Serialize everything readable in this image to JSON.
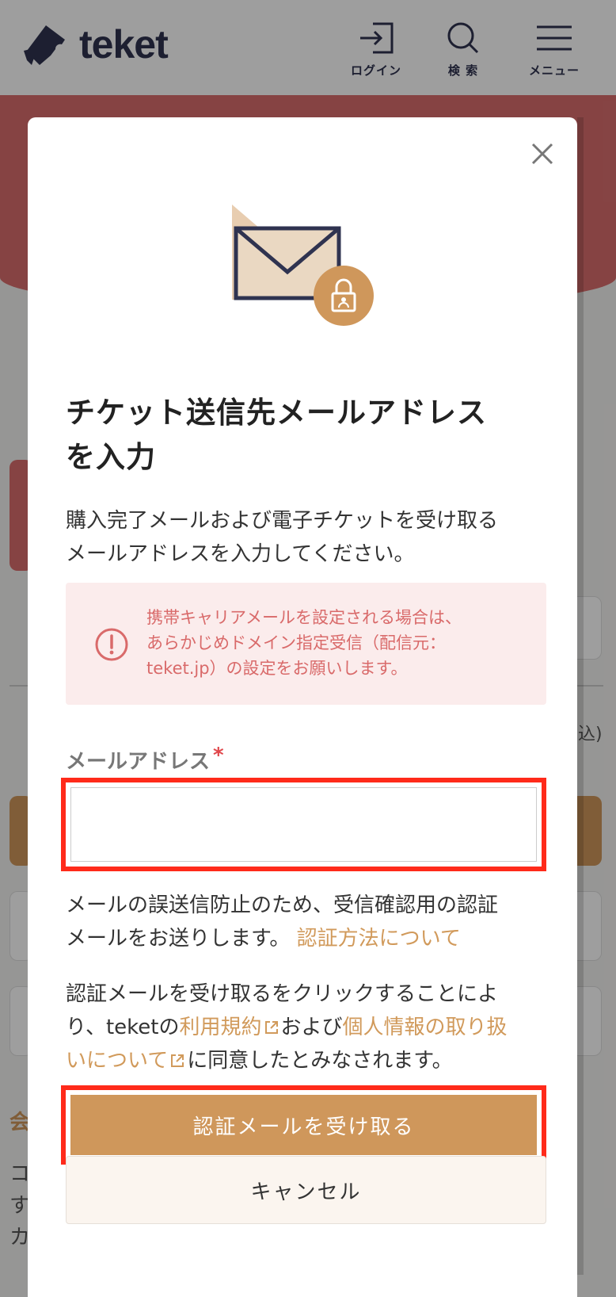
{
  "header": {
    "logo_text": "teket",
    "nav": {
      "login_label": "ログイン",
      "search_label": "検 索",
      "menu_label": "メニュー"
    }
  },
  "background": {
    "fragment_right": "込)",
    "fragment_heading": "会",
    "fragment_lines": [
      "コ",
      "す",
      "カ"
    ]
  },
  "modal": {
    "close_icon": "close-icon",
    "illustration_icon": "mail-lock-icon",
    "title_line1": "チケット送信先メールアドレス",
    "title_line2": "を入力",
    "desc_line1": "購入完了メールおよび電子チケットを受け取る",
    "desc_line2": "メールアドレスを入力してください。",
    "notice": {
      "icon": "alert-circle-icon",
      "line1": "携帯キャリアメールを設定される場合は、",
      "line2": "あらかじめドメイン指定受信（配信元：",
      "line3": "teket.jp）の設定をお願いします。"
    },
    "email_field": {
      "label": "メールアドレス",
      "required_mark": "*",
      "value": "",
      "placeholder": ""
    },
    "info_line1": "メールの誤送信防止のため、受信確認用の認証",
    "info_line2_prefix": "メールをお送りします。",
    "info_link": "認証方法について",
    "terms": {
      "part1": "認証メールを受け取るをクリックすることによ",
      "part2": "り、teketの",
      "terms_link": "利用規約",
      "part3": "および",
      "privacy_link_1": "個人情報の取り扱",
      "privacy_link_2": "いについて",
      "part4": "に同意したとみなされます。"
    },
    "primary_button": "認証メールを受け取る",
    "cancel_button": "キャンセル"
  },
  "colors": {
    "accent": "#cf975b",
    "notice_text": "#d96a6a",
    "notice_bg": "#fbecec",
    "highlight_border": "#ff2a1a",
    "brand_navy": "#2f3350"
  }
}
